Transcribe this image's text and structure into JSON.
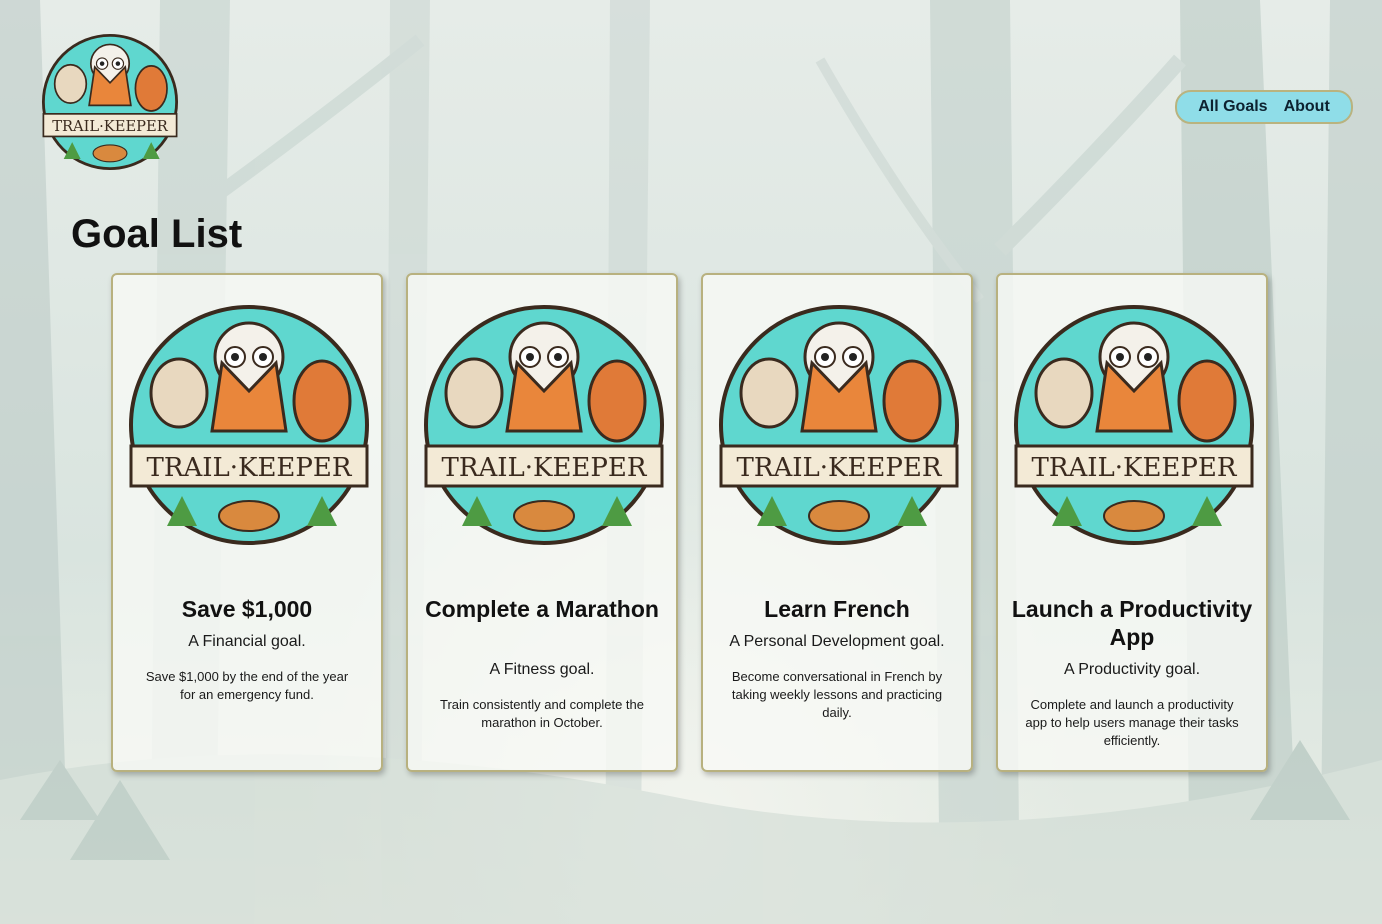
{
  "app": {
    "logo_text": "TRAIL·KEEPER"
  },
  "nav": {
    "items": [
      {
        "label": "All Goals"
      },
      {
        "label": "About"
      }
    ]
  },
  "main": {
    "title": "Goal List",
    "goals": [
      {
        "title": "Save $1,000",
        "category": "A Financial goal.",
        "description": "Save $1,000 by the end of the year for an emergency fund."
      },
      {
        "title": "Complete a Marathon",
        "category": "A Fitness goal.",
        "description": "Train consistently and complete the marathon in October."
      },
      {
        "title": "Learn French",
        "category": "A Personal Development goal.",
        "description": "Become conversational in French by taking weekly lessons and practicing daily."
      },
      {
        "title": "Launch a Productivity App",
        "category": "A Productivity goal.",
        "description": "Complete and launch a productivity app to help users manage their tasks efficiently."
      }
    ],
    "badge_text": "TRAIL·KEEPER"
  },
  "colors": {
    "nav_bg": "#8fdde8",
    "nav_border": "#b9b37f",
    "card_border": "#b8b17f",
    "badge_teal": "#5fd7cf",
    "badge_orange": "#e9863b"
  }
}
